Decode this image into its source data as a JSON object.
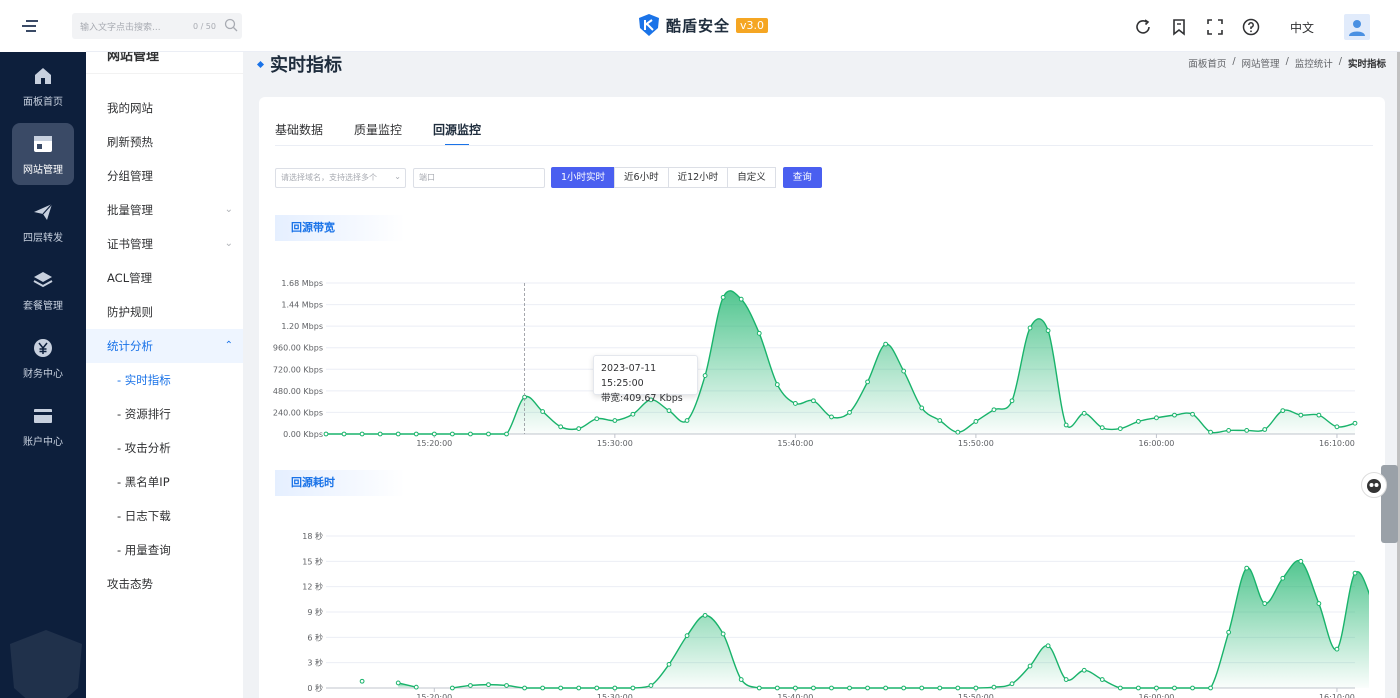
{
  "app": {
    "name": "酷盾安全",
    "version": "v3.0"
  },
  "search": {
    "placeholder": "输入文字点击搜索...",
    "counter": "0 / 50"
  },
  "topbar": {
    "lang": "中文",
    "icons": [
      "refresh-icon",
      "bookmark-icon",
      "fullscreen-icon",
      "help-icon",
      "user-avatar-icon"
    ]
  },
  "rail": [
    {
      "label": "面板首页",
      "icon": "home-icon"
    },
    {
      "label": "网站管理",
      "icon": "website-icon",
      "active": true
    },
    {
      "label": "四层转发",
      "icon": "paper-plane-icon"
    },
    {
      "label": "套餐管理",
      "icon": "layers-icon"
    },
    {
      "label": "财务中心",
      "icon": "yuan-icon"
    },
    {
      "label": "账户中心",
      "icon": "card-icon"
    }
  ],
  "subnav": {
    "title": "网站管理",
    "items": [
      {
        "label": "我的网站"
      },
      {
        "label": "刷新预热"
      },
      {
        "label": "分组管理"
      },
      {
        "label": "批量管理",
        "expandable": true
      },
      {
        "label": "证书管理",
        "expandable": true
      },
      {
        "label": "ACL管理"
      },
      {
        "label": "防护规则"
      },
      {
        "label": "统计分析",
        "expandable": true,
        "open": true
      },
      {
        "label": "- 实时指标",
        "sub": true,
        "active": true
      },
      {
        "label": "- 资源排行",
        "sub": true
      },
      {
        "label": "- 攻击分析",
        "sub": true
      },
      {
        "label": "- 黑名单IP",
        "sub": true
      },
      {
        "label": "- 日志下载",
        "sub": true
      },
      {
        "label": "- 用量查询",
        "sub": true
      },
      {
        "label": "攻击态势"
      }
    ]
  },
  "page": {
    "title": "实时指标",
    "breadcrumb": [
      "面板首页",
      "网站管理",
      "监控统计",
      "实时指标"
    ]
  },
  "tabs": [
    {
      "label": "基础数据"
    },
    {
      "label": "质量监控"
    },
    {
      "label": "回源监控",
      "active": true
    }
  ],
  "filters": {
    "domain_placeholder": "请选择域名，支持选择多个",
    "port_placeholder": "端口",
    "ranges": [
      {
        "label": "1小时实时",
        "active": true
      },
      {
        "label": "近6小时"
      },
      {
        "label": "近12小时"
      },
      {
        "label": "自定义"
      }
    ],
    "query_label": "查询"
  },
  "sections": {
    "bandwidth": "回源带宽",
    "latency": "回源耗时"
  },
  "tooltip": {
    "time": "2023-07-11 15:25:00",
    "value": "带宽:409.67 Kbps"
  },
  "colors": {
    "accent": "#1a73e8",
    "line": "#19b36b",
    "button": "#4a5ff0",
    "rail": "#0d1f3c"
  },
  "chart_data": [
    {
      "type": "area",
      "title": "回源带宽",
      "x": [
        "15:14",
        "15:15",
        "15:16",
        "15:17",
        "15:18",
        "15:19",
        "15:20",
        "15:21",
        "15:22",
        "15:23",
        "15:24",
        "15:25",
        "15:26",
        "15:27",
        "15:28",
        "15:29",
        "15:30",
        "15:31",
        "15:32",
        "15:33",
        "15:34",
        "15:35",
        "15:36",
        "15:37",
        "15:38",
        "15:39",
        "15:40",
        "15:41",
        "15:42",
        "15:43",
        "15:44",
        "15:45",
        "15:46",
        "15:47",
        "15:48",
        "15:49",
        "15:50",
        "15:51",
        "15:52",
        "15:53",
        "15:54",
        "15:55",
        "15:56",
        "15:57",
        "15:58",
        "15:59",
        "16:00",
        "16:01",
        "16:02",
        "16:03",
        "16:04",
        "16:05",
        "16:06",
        "16:07",
        "16:08",
        "16:09",
        "16:10",
        "16:11"
      ],
      "xticks": [
        "15:20:00",
        "15:30:00",
        "15:40:00",
        "15:50:00",
        "16:00:00",
        "16:10:00"
      ],
      "yticks": [
        "0.00 Kbps",
        "240.00 Kbps",
        "480.00 Kbps",
        "720.00 Kbps",
        "960.00 Kbps",
        "1.20 Mbps",
        "1.44 Mbps",
        "1.68 Mbps"
      ],
      "ylim": [
        0,
        1680
      ],
      "unit": "Kbps",
      "series": [
        {
          "values": [
            0,
            0,
            0,
            0,
            0,
            0,
            0,
            0,
            0,
            0,
            0,
            410,
            250,
            80,
            60,
            170,
            150,
            220,
            380,
            260,
            150,
            650,
            1520,
            1500,
            1120,
            550,
            340,
            370,
            190,
            240,
            580,
            1000,
            700,
            290,
            150,
            20,
            140,
            270,
            370,
            1180,
            1150,
            100,
            230,
            70,
            60,
            140,
            180,
            210,
            220,
            20,
            40,
            40,
            50,
            260,
            210,
            210,
            80,
            120
          ]
        }
      ],
      "tooltip_index": 11
    },
    {
      "type": "area",
      "title": "回源耗时",
      "x": [
        "15:14",
        "15:15",
        "15:16",
        "15:17",
        "15:18",
        "15:19",
        "15:20",
        "15:21",
        "15:22",
        "15:23",
        "15:24",
        "15:25",
        "15:26",
        "15:27",
        "15:28",
        "15:29",
        "15:30",
        "15:31",
        "15:32",
        "15:33",
        "15:34",
        "15:35",
        "15:36",
        "15:37",
        "15:38",
        "15:39",
        "15:40",
        "15:41",
        "15:42",
        "15:43",
        "15:44",
        "15:45",
        "15:46",
        "15:47",
        "15:48",
        "15:49",
        "15:50",
        "15:51",
        "15:52",
        "15:53",
        "15:54",
        "15:55",
        "15:56",
        "15:57",
        "15:58",
        "15:59",
        "16:00",
        "16:01",
        "16:02",
        "16:03",
        "16:04",
        "16:05",
        "16:06",
        "16:07",
        "16:08",
        "16:09",
        "16:10",
        "16:11"
      ],
      "xticks": [
        "15:20:00",
        "15:30:00",
        "15:40:00",
        "15:50:00",
        "16:00:00",
        "16:10:00"
      ],
      "yticks": [
        "0 秒",
        "3 秒",
        "6 秒",
        "9 秒",
        "12 秒",
        "15 秒",
        "18 秒"
      ],
      "ylim": [
        0,
        18
      ],
      "unit": "秒",
      "series": [
        {
          "values": [
            null,
            null,
            0.8,
            null,
            0.6,
            0.1,
            null,
            0,
            0.3,
            0.4,
            0.3,
            0,
            0,
            0,
            0,
            0,
            0,
            0,
            0.3,
            2.8,
            6.2,
            8.6,
            6.4,
            1,
            0,
            0,
            0,
            0,
            0,
            0,
            0,
            0,
            0,
            0,
            0,
            0,
            0,
            0.1,
            0.5,
            2.6,
            5.0,
            1,
            2.1,
            1,
            0,
            0,
            0,
            0,
            0,
            0,
            6.6,
            14.2,
            10.0,
            13.0,
            15.0,
            10.0,
            4.6,
            13.6,
            9.9,
            2.4,
            5.4,
            4.8
          ]
        }
      ]
    }
  ]
}
